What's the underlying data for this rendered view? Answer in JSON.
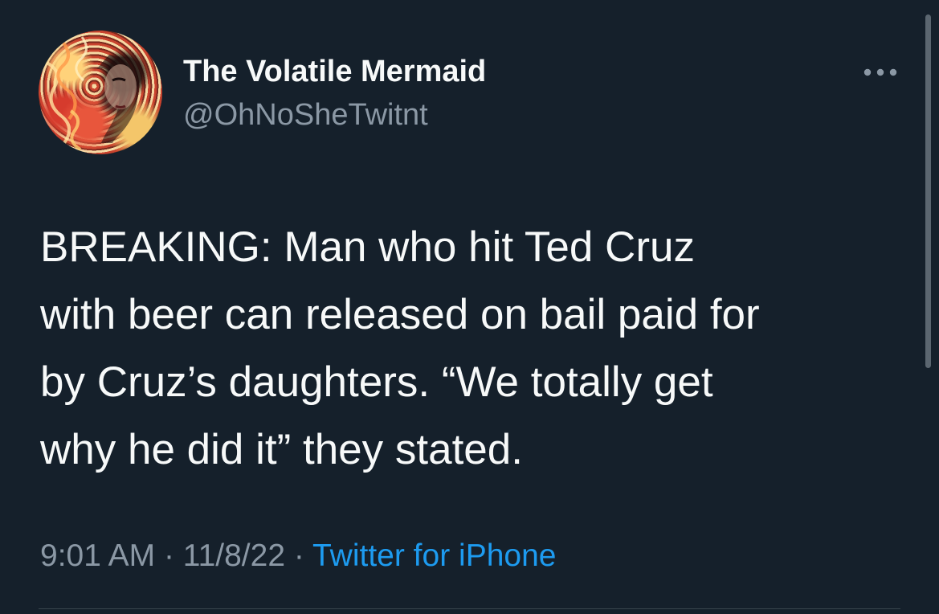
{
  "tweet": {
    "author": {
      "display_name": "The Volatile Mermaid",
      "handle": "@OhNoSheTwitnt"
    },
    "text": "BREAKING: Man who hit Ted Cruz\nwith beer can released on bail paid for\nby Cruz’s daughters. “We totally get\nwhy he did it” they stated.",
    "time": "9:01 AM",
    "date": "11/8/22",
    "separator": "·",
    "source": "Twitter for iPhone",
    "more_icon": "more-horizontal-icon"
  },
  "colors": {
    "background": "#15202b",
    "text": "#f7f9f9",
    "secondary_text": "#8b98a5",
    "link": "#1d9bf0",
    "divider": "#38444d"
  }
}
